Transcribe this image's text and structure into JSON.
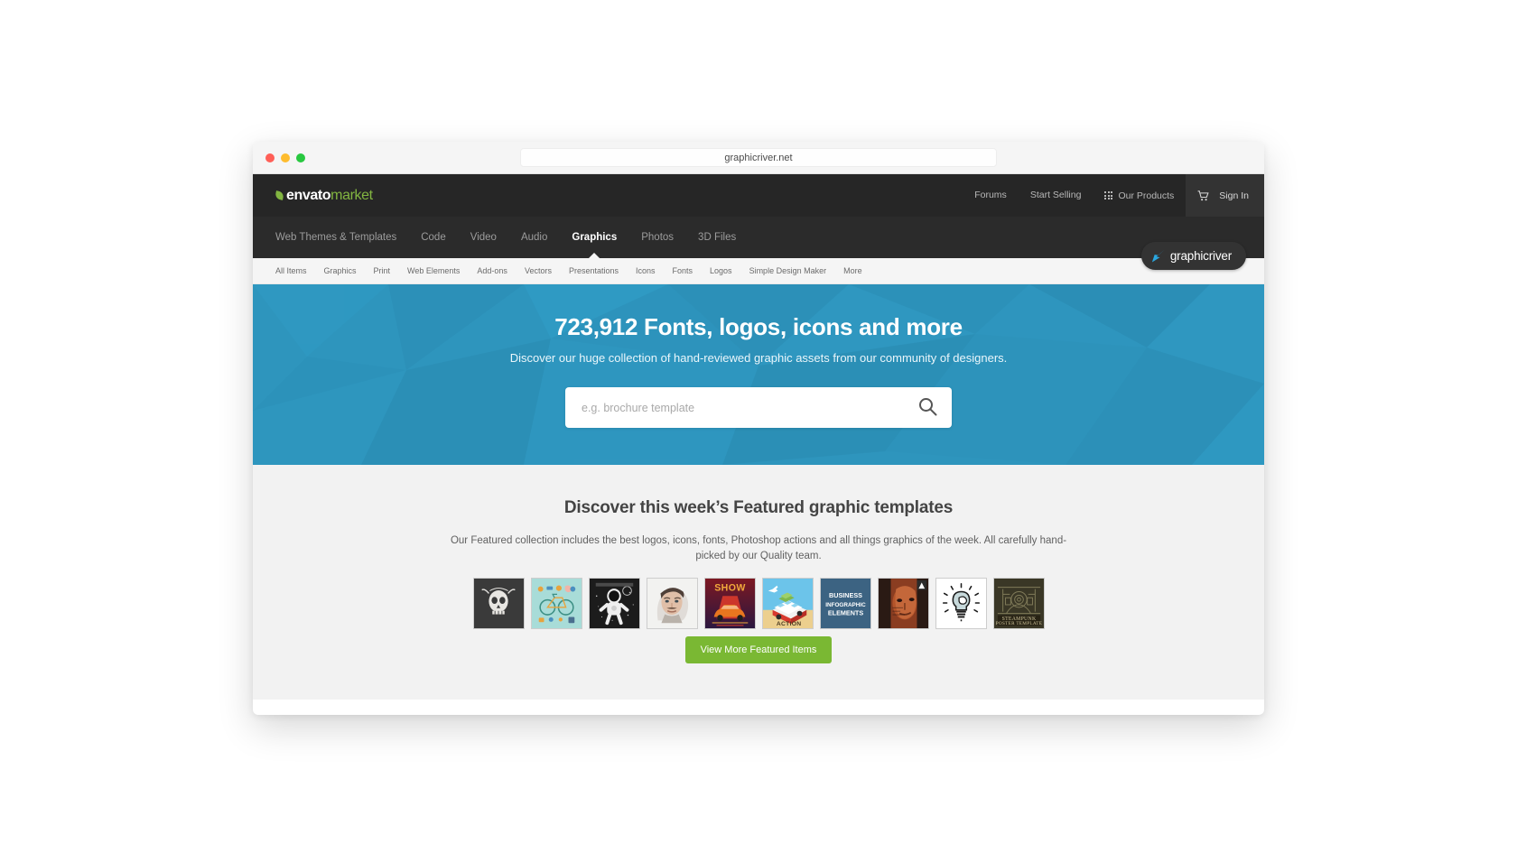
{
  "browser": {
    "url": "graphicriver.net",
    "traffic_lights": [
      "close",
      "minimize",
      "maximize"
    ]
  },
  "header": {
    "logo": {
      "envato": "envato",
      "market": "market",
      "leaf_icon": "leaf-icon"
    },
    "links": [
      {
        "label": "Forums",
        "name": "forums"
      },
      {
        "label": "Start Selling",
        "name": "start-selling"
      }
    ],
    "our_products": {
      "label": "Our Products",
      "icon": "grid-apps-icon"
    },
    "sign_in": {
      "label": "Sign In",
      "icon": "shopping-cart-icon"
    }
  },
  "main_nav": {
    "tabs": [
      {
        "label": "Web Themes & Templates",
        "active": false
      },
      {
        "label": "Code",
        "active": false
      },
      {
        "label": "Video",
        "active": false
      },
      {
        "label": "Audio",
        "active": false
      },
      {
        "label": "Graphics",
        "active": true
      },
      {
        "label": "Photos",
        "active": false
      },
      {
        "label": "3D Files",
        "active": false
      }
    ],
    "badge": {
      "label": "graphicriver",
      "icon": "graphicriver-mark-icon"
    }
  },
  "category_bar": {
    "items": [
      "All Items",
      "Graphics",
      "Print",
      "Web Elements",
      "Add-ons",
      "Vectors",
      "Presentations",
      "Icons",
      "Fonts",
      "Logos",
      "Simple Design Maker",
      "More"
    ]
  },
  "hero": {
    "title": "723,912 Fonts, logos, icons and more",
    "subtitle": "Discover our huge collection of hand-reviewed graphic assets from our community of designers.",
    "search": {
      "placeholder": "e.g. brochure template",
      "value": "",
      "icon": "search-icon"
    },
    "background_color": "#2e95bd"
  },
  "featured": {
    "title": "Discover this week’s Featured graphic templates",
    "description": "Our Featured collection includes the best logos, icons, fonts, Photoshop actions and all things graphics of the week. All carefully hand-picked by our Quality team.",
    "thumbnails": [
      {
        "name": "skull-illustration",
        "alt": "Skull illustration"
      },
      {
        "name": "bicycle-infographic",
        "alt": "Bicycle infographic"
      },
      {
        "name": "astronaut-poster",
        "alt": "Astronaut poster"
      },
      {
        "name": "watercolor-portrait",
        "alt": "Watercolor portrait"
      },
      {
        "name": "show-car-poster",
        "alt": "SHOW car poster",
        "text": "SHOW"
      },
      {
        "name": "camper-van-action",
        "alt": "Camper van action",
        "text": "ACTION"
      },
      {
        "name": "business-infographic-elements",
        "alt": "Business infographic elements",
        "text": "BUSINESS INFOGRAPHIC ELEMENTS"
      },
      {
        "name": "face-portrait-effect",
        "alt": "Face portrait effect"
      },
      {
        "name": "lightbulb-icon-art",
        "alt": "Lightbulb icon art"
      },
      {
        "name": "steampunk-poster-template",
        "alt": "Steampunk poster template",
        "text": "STEAMPUNK POSTER TEMPLATE"
      }
    ],
    "cta_label": "View More Featured Items",
    "cta_color": "#7ab833"
  }
}
